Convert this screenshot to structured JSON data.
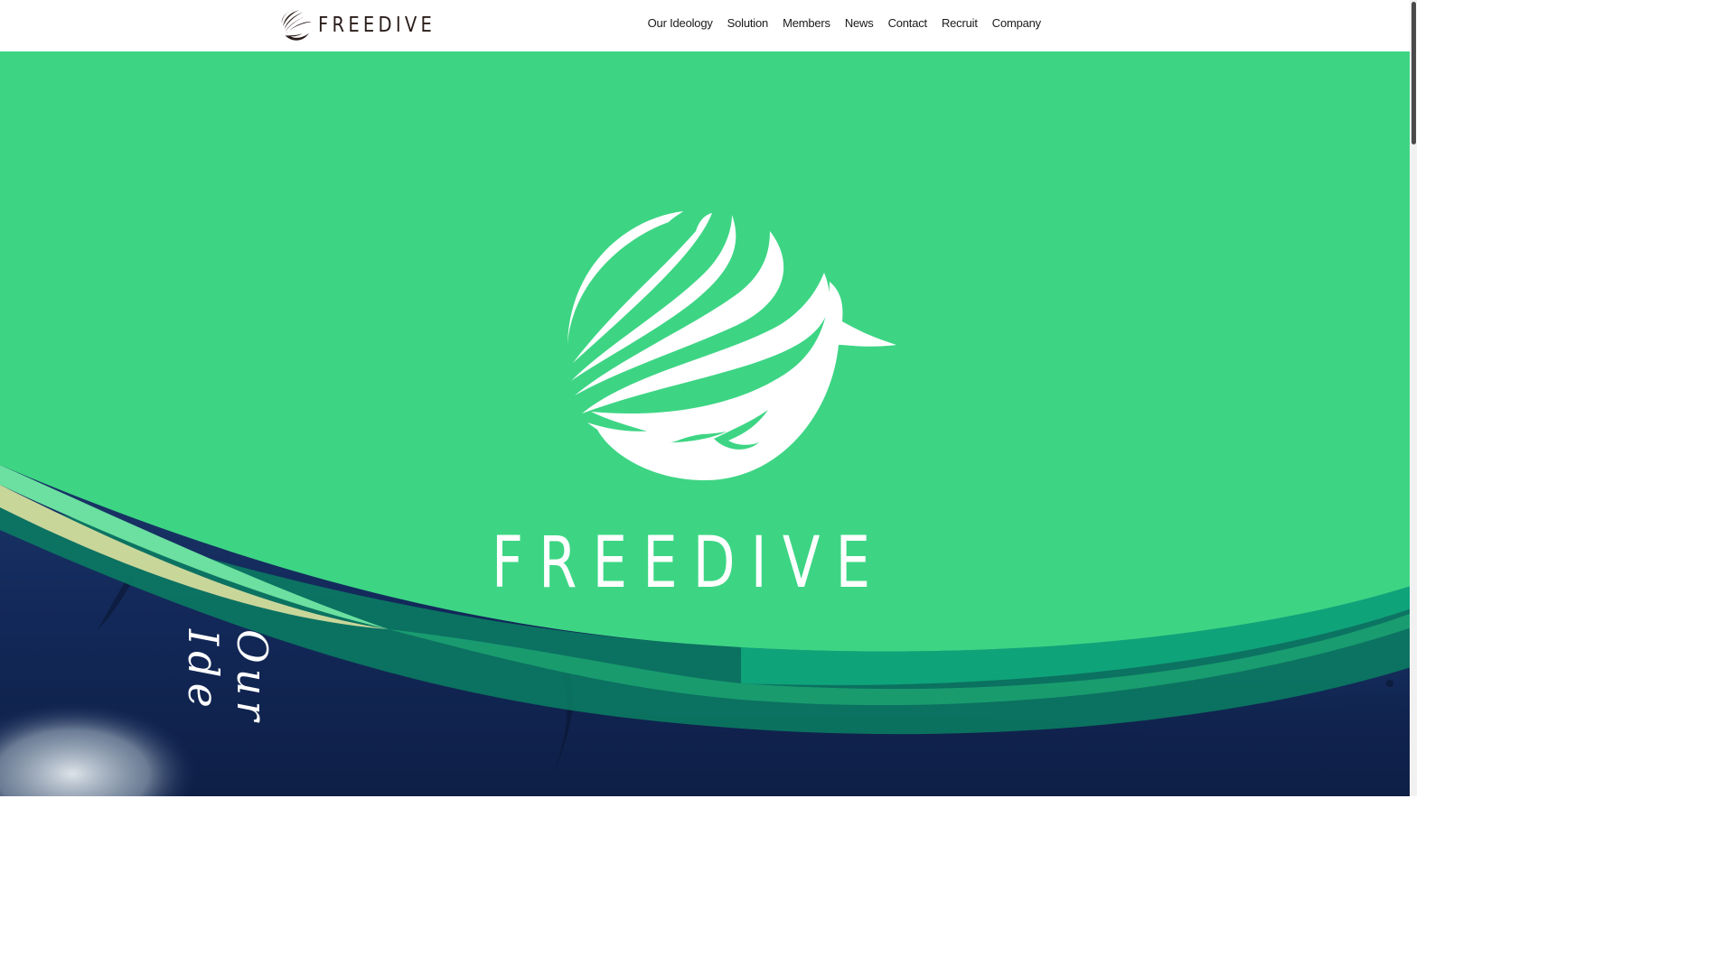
{
  "header": {
    "logo_text": "FREEDIVE",
    "nav": [
      {
        "label": "Our Ideology"
      },
      {
        "label": "Solution"
      },
      {
        "label": "Members"
      },
      {
        "label": "News"
      },
      {
        "label": "Contact"
      },
      {
        "label": "Recruit"
      },
      {
        "label": "Company"
      }
    ]
  },
  "hero": {
    "title": "FREEDIVE",
    "vertical_text": "Our Ide"
  },
  "colors": {
    "brand_green": "#3dd584",
    "dark_teal": "#0fa37a",
    "ocean_blue": "#13295a",
    "header_text": "#2a1d1a",
    "white": "#ffffff"
  },
  "icons": {
    "logo_mark": "freedive-whale-emblem-icon",
    "hero_emblem": "whale-emblem-icon"
  }
}
